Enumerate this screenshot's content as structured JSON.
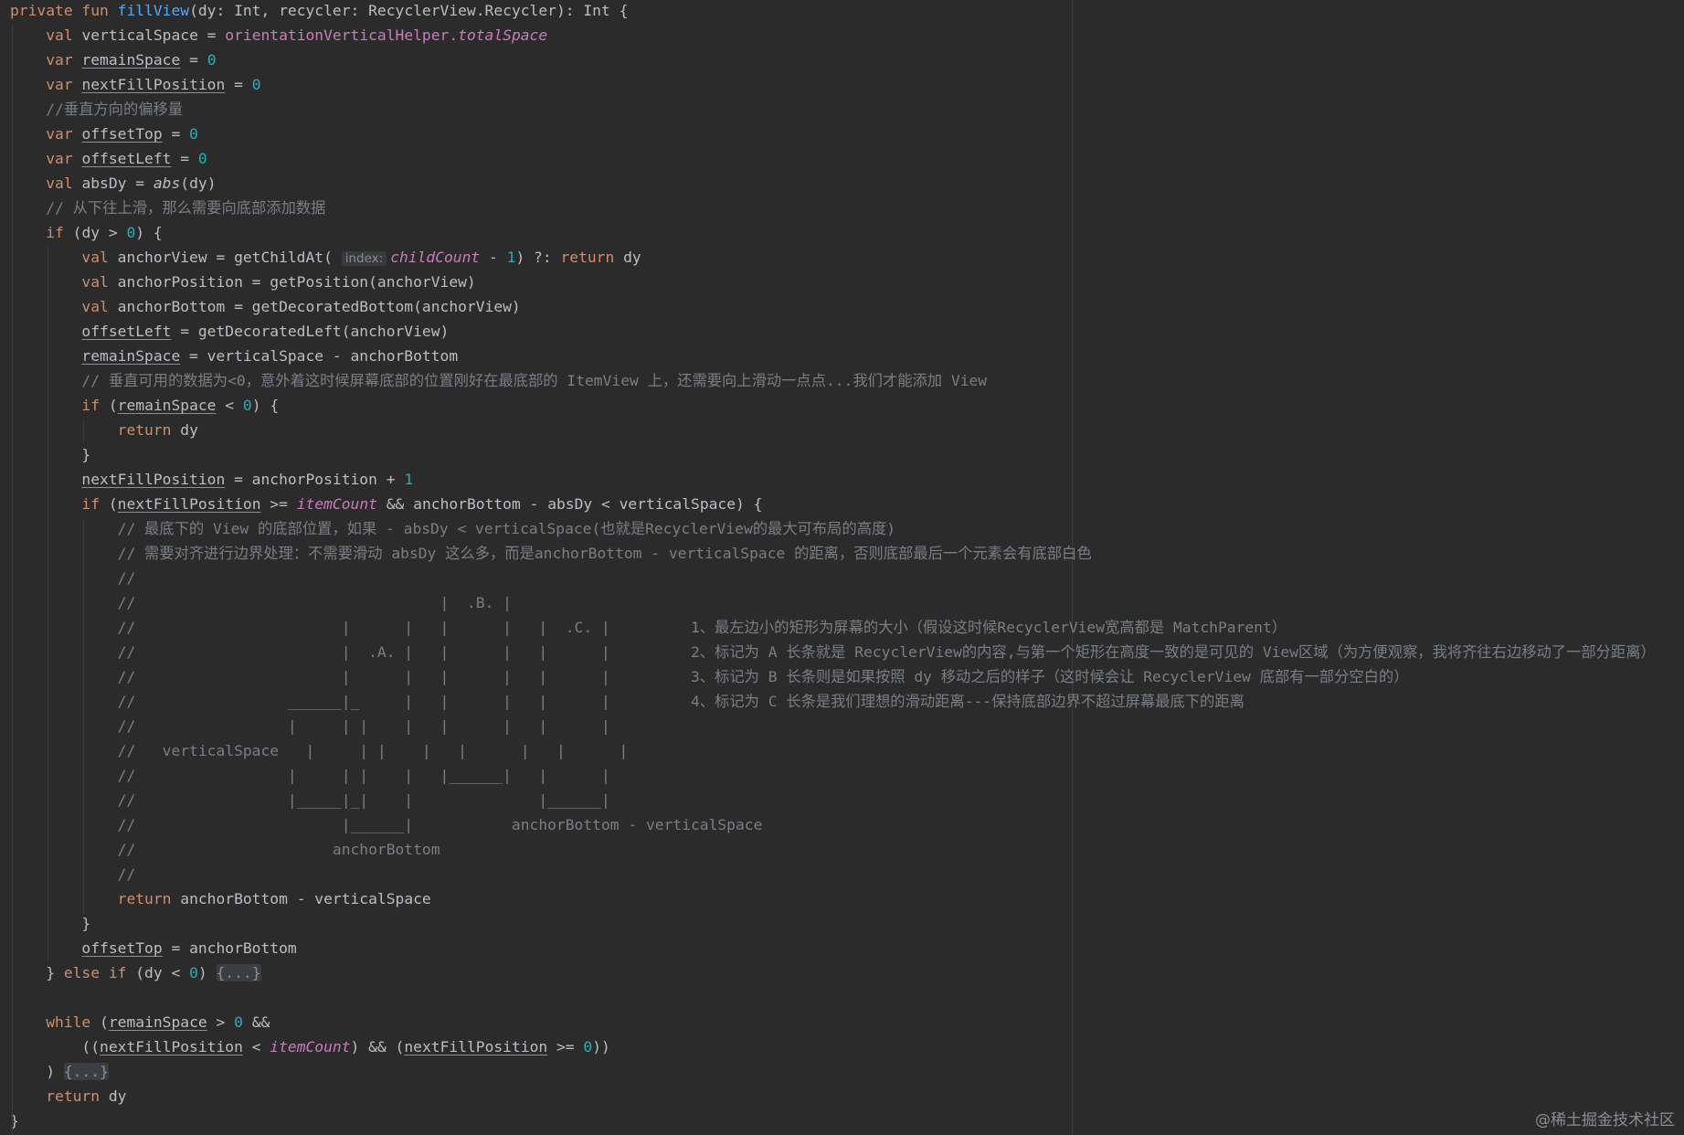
{
  "editor": {
    "lines": [
      [
        {
          "t": "private fun ",
          "c": "kw"
        },
        {
          "t": "fillView",
          "c": "fn"
        },
        {
          "t": "(dy: Int, recycler: RecyclerView.Recycler): Int {"
        }
      ],
      [
        {
          "t": "    "
        },
        {
          "t": "val ",
          "c": "kw"
        },
        {
          "t": "verticalSpace = "
        },
        {
          "t": "orientationVerticalHelper.",
          "c": "prop"
        },
        {
          "t": "totalSpace",
          "c": "prop it"
        }
      ],
      [
        {
          "t": "    "
        },
        {
          "t": "var ",
          "c": "kw"
        },
        {
          "t": "remainSpace",
          "c": "ul"
        },
        {
          "t": " = "
        },
        {
          "t": "0",
          "c": "num"
        }
      ],
      [
        {
          "t": "    "
        },
        {
          "t": "var ",
          "c": "kw"
        },
        {
          "t": "nextFillPosition",
          "c": "ul"
        },
        {
          "t": " = "
        },
        {
          "t": "0",
          "c": "num"
        }
      ],
      [
        {
          "t": "    "
        },
        {
          "t": "//垂直方向的偏移量",
          "c": "cm"
        }
      ],
      [
        {
          "t": "    "
        },
        {
          "t": "var ",
          "c": "kw"
        },
        {
          "t": "offsetTop",
          "c": "ul"
        },
        {
          "t": " = "
        },
        {
          "t": "0",
          "c": "num"
        }
      ],
      [
        {
          "t": "    "
        },
        {
          "t": "var ",
          "c": "kw"
        },
        {
          "t": "offsetLeft",
          "c": "ul"
        },
        {
          "t": " = "
        },
        {
          "t": "0",
          "c": "num"
        }
      ],
      [
        {
          "t": "    "
        },
        {
          "t": "val ",
          "c": "kw"
        },
        {
          "t": "absDy = "
        },
        {
          "t": "abs",
          "c": "it"
        },
        {
          "t": "(dy)"
        }
      ],
      [
        {
          "t": "    "
        },
        {
          "t": "// 从下往上滑，那么需要向底部添加数据",
          "c": "cm"
        }
      ],
      [
        {
          "t": "    "
        },
        {
          "t": "if ",
          "c": "kw"
        },
        {
          "t": "(dy > "
        },
        {
          "t": "0",
          "c": "num"
        },
        {
          "t": ") {"
        }
      ],
      [
        {
          "t": "        "
        },
        {
          "t": "val ",
          "c": "kw"
        },
        {
          "t": "anchorView = getChildAt( "
        },
        {
          "t": "index:",
          "c": "hint"
        },
        {
          "t": "childCount",
          "c": "prop it"
        },
        {
          "t": " - "
        },
        {
          "t": "1",
          "c": "num"
        },
        {
          "t": ") ?: "
        },
        {
          "t": "return ",
          "c": "kw"
        },
        {
          "t": "dy"
        }
      ],
      [
        {
          "t": "        "
        },
        {
          "t": "val ",
          "c": "kw"
        },
        {
          "t": "anchorPosition = getPosition(anchorView)"
        }
      ],
      [
        {
          "t": "        "
        },
        {
          "t": "val ",
          "c": "kw"
        },
        {
          "t": "anchorBottom = getDecoratedBottom(anchorView)"
        }
      ],
      [
        {
          "t": "        "
        },
        {
          "t": "offsetLeft",
          "c": "ul"
        },
        {
          "t": " = getDecoratedLeft(anchorView)"
        }
      ],
      [
        {
          "t": "        "
        },
        {
          "t": "remainSpace",
          "c": "ul"
        },
        {
          "t": " = verticalSpace - anchorBottom"
        }
      ],
      [
        {
          "t": "        "
        },
        {
          "t": "// 垂直可用的数据为<0，意外着这时候屏幕底部的位置刚好在最底部的 ItemView 上，还需要向上滑动一点点...我们才能添加 View",
          "c": "cm"
        }
      ],
      [
        {
          "t": "        "
        },
        {
          "t": "if ",
          "c": "kw"
        },
        {
          "t": "("
        },
        {
          "t": "remainSpace",
          "c": "ul"
        },
        {
          "t": " < "
        },
        {
          "t": "0",
          "c": "num"
        },
        {
          "t": ") {"
        }
      ],
      [
        {
          "t": "            "
        },
        {
          "t": "return ",
          "c": "kw"
        },
        {
          "t": "dy"
        }
      ],
      [
        {
          "t": "        }"
        }
      ],
      [
        {
          "t": "        "
        },
        {
          "t": "nextFillPosition",
          "c": "ul"
        },
        {
          "t": " = anchorPosition + "
        },
        {
          "t": "1",
          "c": "num"
        }
      ],
      [
        {
          "t": "        "
        },
        {
          "t": "if ",
          "c": "kw"
        },
        {
          "t": "("
        },
        {
          "t": "nextFillPosition",
          "c": "ul"
        },
        {
          "t": " >= "
        },
        {
          "t": "itemCount",
          "c": "prop it"
        },
        {
          "t": " && anchorBottom - absDy < verticalSpace) {"
        }
      ],
      [
        {
          "t": "            "
        },
        {
          "t": "// 最底下的 View 的底部位置，如果 - absDy < verticalSpace(也就是RecyclerView的最大可布局的高度)",
          "c": "cm"
        }
      ],
      [
        {
          "t": "            "
        },
        {
          "t": "// 需要对齐进行边界处理：不需要滑动 absDy 这么多，而是anchorBottom - verticalSpace 的距离，否则底部最后一个元素会有底部白色",
          "c": "cm"
        }
      ],
      [
        {
          "t": "            "
        },
        {
          "t": "//",
          "c": "cm"
        }
      ],
      [
        {
          "t": "            "
        },
        {
          "t": "//                                  |  .B. |",
          "c": "cm"
        }
      ],
      [
        {
          "t": "            "
        },
        {
          "t": "//                       |      |   |      |   |  .C. |         1、最左边小的矩形为屏幕的大小（假设这时候RecyclerView宽高都是 MatchParent）",
          "c": "cm"
        }
      ],
      [
        {
          "t": "            "
        },
        {
          "t": "//                       |  .A. |   |      |   |      |         2、标记为 A 长条就是 RecyclerView的内容,与第一个矩形在高度一致的是可见的 View区域（为方便观察，我将齐往右边移动了一部分距离）",
          "c": "cm"
        }
      ],
      [
        {
          "t": "            "
        },
        {
          "t": "//                       |      |   |      |   |      |         3、标记为 B 长条则是如果按照 dy 移动之后的样子（这时候会让 RecyclerView 底部有一部分空白的）",
          "c": "cm"
        }
      ],
      [
        {
          "t": "            "
        },
        {
          "t": "//                 ______|_     |   |      |   |      |         4、标记为 C 长条是我们理想的滑动距离---保持底部边界不超过屏幕最底下的距离",
          "c": "cm"
        }
      ],
      [
        {
          "t": "            "
        },
        {
          "t": "//                 |     | |    |   |      |   |      |",
          "c": "cm"
        }
      ],
      [
        {
          "t": "            "
        },
        {
          "t": "//   verticalSpace   |     | |    |   |      |   |      |",
          "c": "cm"
        }
      ],
      [
        {
          "t": "            "
        },
        {
          "t": "//                 |     | |    |   |______|   |      |",
          "c": "cm"
        }
      ],
      [
        {
          "t": "            "
        },
        {
          "t": "//                 |_____|_|    |              |______|",
          "c": "cm"
        }
      ],
      [
        {
          "t": "            "
        },
        {
          "t": "//                       |______|           anchorBottom - verticalSpace",
          "c": "cm"
        }
      ],
      [
        {
          "t": "            "
        },
        {
          "t": "//                      anchorBottom",
          "c": "cm"
        }
      ],
      [
        {
          "t": "            "
        },
        {
          "t": "//",
          "c": "cm"
        }
      ],
      [
        {
          "t": "            "
        },
        {
          "t": "return ",
          "c": "kw"
        },
        {
          "t": "anchorBottom - verticalSpace"
        }
      ],
      [
        {
          "t": "        }"
        }
      ],
      [
        {
          "t": "        "
        },
        {
          "t": "offsetTop",
          "c": "ul"
        },
        {
          "t": " = anchorBottom"
        }
      ],
      [
        {
          "t": "    } "
        },
        {
          "t": "else if ",
          "c": "kw"
        },
        {
          "t": "(dy < "
        },
        {
          "t": "0",
          "c": "num"
        },
        {
          "t": ") "
        },
        {
          "t": "{...}",
          "c": "fold"
        }
      ],
      [],
      [
        {
          "t": "    "
        },
        {
          "t": "while ",
          "c": "kw"
        },
        {
          "t": "("
        },
        {
          "t": "remainSpace",
          "c": "ul"
        },
        {
          "t": " > "
        },
        {
          "t": "0",
          "c": "num"
        },
        {
          "t": " &&"
        }
      ],
      [
        {
          "t": "        (("
        },
        {
          "t": "nextFillPosition",
          "c": "ul"
        },
        {
          "t": " < "
        },
        {
          "t": "itemCount",
          "c": "prop it"
        },
        {
          "t": ") && ("
        },
        {
          "t": "nextFillPosition",
          "c": "ul"
        },
        {
          "t": " >= "
        },
        {
          "t": "0",
          "c": "num"
        },
        {
          "t": "))"
        }
      ],
      [
        {
          "t": "    ) "
        },
        {
          "t": "{...}",
          "c": "fold"
        }
      ],
      [
        {
          "t": "    "
        },
        {
          "t": "return ",
          "c": "kw"
        },
        {
          "t": "dy"
        }
      ],
      [
        {
          "t": "}"
        }
      ]
    ],
    "indent_guides": [
      {
        "col": 0,
        "from": 1,
        "to": 45
      },
      {
        "col": 4,
        "from": 10,
        "to": 38
      },
      {
        "col": 8,
        "from": 17,
        "to": 17
      },
      {
        "col": 8,
        "from": 21,
        "to": 36
      }
    ]
  },
  "watermark": "@稀土掘金技术社区"
}
